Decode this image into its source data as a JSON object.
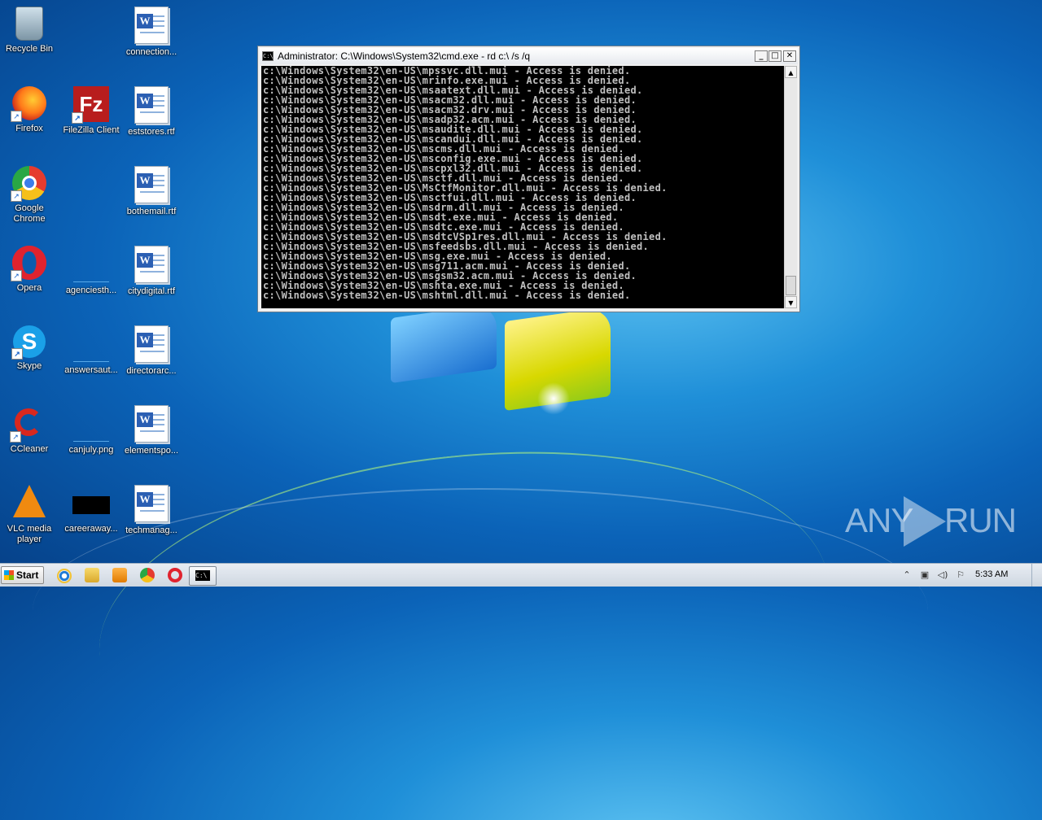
{
  "desktop": {
    "icons": [
      {
        "id": "recycle-bin",
        "label": "Recycle Bin"
      },
      {
        "id": "firefox",
        "label": "Firefox"
      },
      {
        "id": "google-chrome",
        "label": "Google Chrome"
      },
      {
        "id": "opera",
        "label": "Opera"
      },
      {
        "id": "skype",
        "label": "Skype"
      },
      {
        "id": "ccleaner",
        "label": "CCleaner"
      },
      {
        "id": "vlc",
        "label": "VLC media player"
      },
      {
        "id": "filezilla",
        "label": "FileZilla Client"
      },
      {
        "id": "agenciesth",
        "label": "agenciesth..."
      },
      {
        "id": "answersaut",
        "label": "answersaut..."
      },
      {
        "id": "canjuly",
        "label": "canjuly.png"
      },
      {
        "id": "careeraway",
        "label": "careeraway..."
      },
      {
        "id": "connection",
        "label": "connection..."
      },
      {
        "id": "eststores",
        "label": "eststores.rtf"
      },
      {
        "id": "bothemail",
        "label": "bothemail.rtf"
      },
      {
        "id": "citydigital",
        "label": "citydigital.rtf"
      },
      {
        "id": "directorarc",
        "label": "directorarc..."
      },
      {
        "id": "elementspo",
        "label": "elementspo..."
      },
      {
        "id": "techmanag",
        "label": "techmanag..."
      }
    ]
  },
  "cmd_window": {
    "title": "Administrator: C:\\Windows\\System32\\cmd.exe - rd  c:\\ /s /q",
    "icon_text": "C:\\",
    "buttons": {
      "minimize": "_",
      "maximize": "□",
      "close": "✕"
    },
    "lines": [
      "c:\\Windows\\System32\\en-US\\mpssvc.dll.mui - Access is denied.",
      "c:\\Windows\\System32\\en-US\\mrinfo.exe.mui - Access is denied.",
      "c:\\Windows\\System32\\en-US\\msaatext.dll.mui - Access is denied.",
      "c:\\Windows\\System32\\en-US\\msacm32.dll.mui - Access is denied.",
      "c:\\Windows\\System32\\en-US\\msacm32.drv.mui - Access is denied.",
      "c:\\Windows\\System32\\en-US\\msadp32.acm.mui - Access is denied.",
      "c:\\Windows\\System32\\en-US\\msaudite.dll.mui - Access is denied.",
      "c:\\Windows\\System32\\en-US\\mscandui.dll.mui - Access is denied.",
      "c:\\Windows\\System32\\en-US\\mscms.dll.mui - Access is denied.",
      "c:\\Windows\\System32\\en-US\\msconfig.exe.mui - Access is denied.",
      "c:\\Windows\\System32\\en-US\\mscpxl32.dll.mui - Access is denied.",
      "c:\\Windows\\System32\\en-US\\msctf.dll.mui - Access is denied.",
      "c:\\Windows\\System32\\en-US\\MsCtfMonitor.dll.mui - Access is denied.",
      "c:\\Windows\\System32\\en-US\\msctfui.dll.mui - Access is denied.",
      "c:\\Windows\\System32\\en-US\\msdrm.dll.mui - Access is denied.",
      "c:\\Windows\\System32\\en-US\\msdt.exe.mui - Access is denied.",
      "c:\\Windows\\System32\\en-US\\msdtc.exe.mui - Access is denied.",
      "c:\\Windows\\System32\\en-US\\msdtcVSp1res.dll.mui - Access is denied.",
      "c:\\Windows\\System32\\en-US\\msfeedsbs.dll.mui - Access is denied.",
      "c:\\Windows\\System32\\en-US\\msg.exe.mui - Access is denied.",
      "c:\\Windows\\System32\\en-US\\msg711.acm.mui - Access is denied.",
      "c:\\Windows\\System32\\en-US\\msgsm32.acm.mui - Access is denied.",
      "c:\\Windows\\System32\\en-US\\mshta.exe.mui - Access is denied.",
      "c:\\Windows\\System32\\en-US\\mshtml.dll.mui - Access is denied."
    ]
  },
  "watermark": {
    "left": "ANY",
    "right": "RUN"
  },
  "taskbar": {
    "start_label": "Start",
    "pinned": [
      "internet-explorer-icon",
      "windows-explorer-icon",
      "media-player-icon",
      "chrome-icon",
      "opera-icon",
      "cmd-icon"
    ],
    "tray_icons": [
      "show-hidden-icon",
      "network-icon",
      "volume-icon",
      "action-center-flag-icon"
    ],
    "clock": "5:33 AM"
  }
}
